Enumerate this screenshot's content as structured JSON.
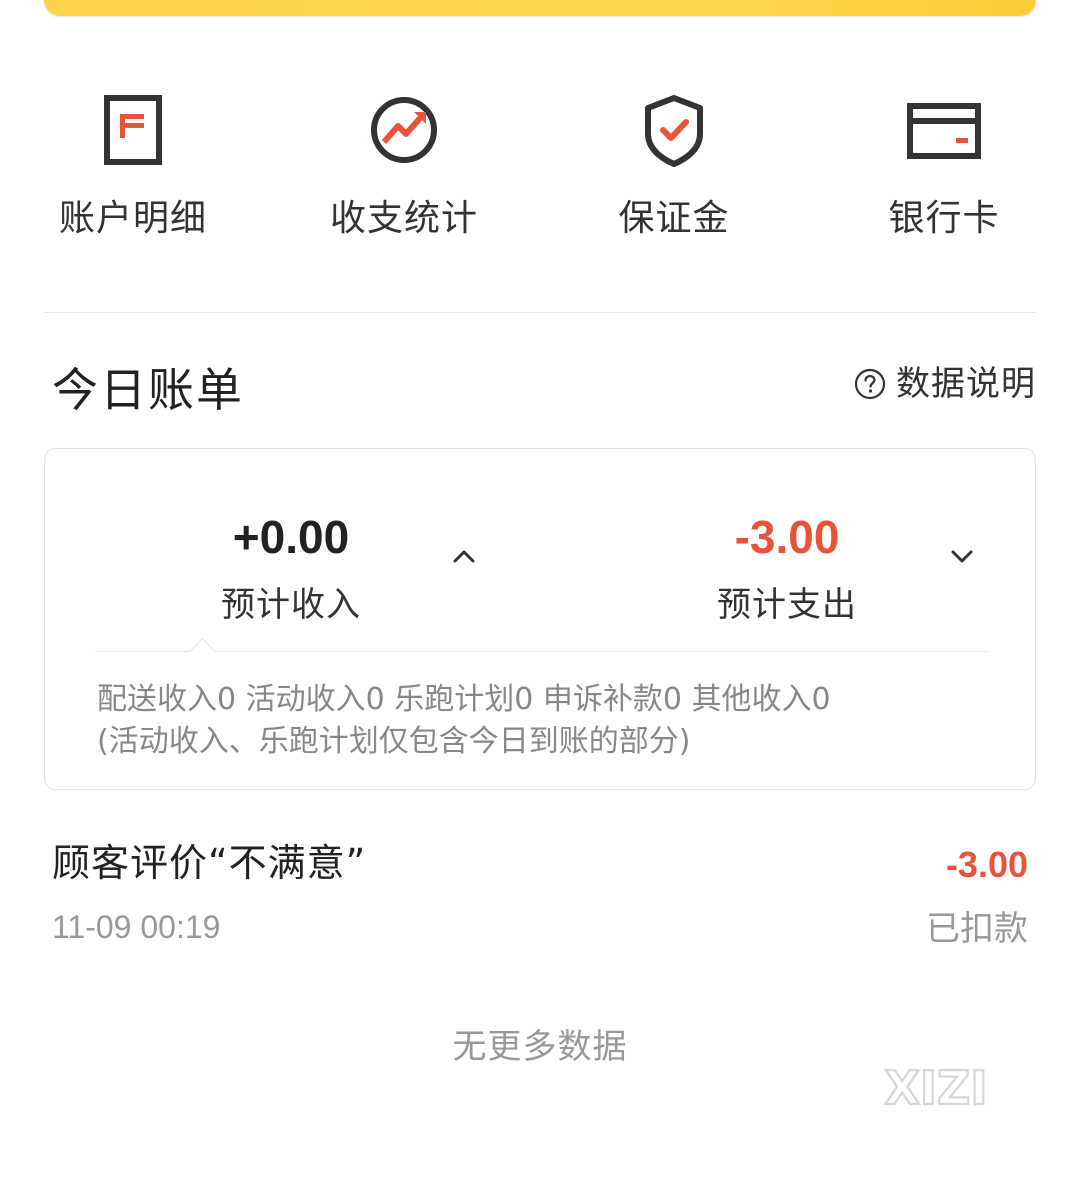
{
  "quick_nav": {
    "items": [
      {
        "label": "账户明细",
        "icon": "account-detail-icon"
      },
      {
        "label": "收支统计",
        "icon": "stats-trend-icon"
      },
      {
        "label": "保证金",
        "icon": "shield-check-icon"
      },
      {
        "label": "银行卡",
        "icon": "bank-card-icon"
      }
    ]
  },
  "today_bill": {
    "title": "今日账单",
    "help_label": "数据说明",
    "income": {
      "amount": "+0.00",
      "label": "预计收入"
    },
    "expense": {
      "amount": "-3.00",
      "label": "预计支出"
    },
    "breakdown_line1": "配送收入0 活动收入0 乐跑计划0 申诉补款0 其他收入0",
    "breakdown_line2": "(活动收入、乐跑计划仅包含今日到账的部分)"
  },
  "records": [
    {
      "title": "顾客评价“不满意”",
      "time": "11-09 00:19",
      "amount": "-3.00",
      "status": "已扣款"
    }
  ],
  "footer": {
    "no_more": "无更多数据"
  },
  "watermark": {
    "text": "XIZI"
  },
  "colors": {
    "accent_red": "#e8533a",
    "banner_yellow": "#fcd64c",
    "text_dark": "#333333",
    "text_grey": "#999999"
  }
}
